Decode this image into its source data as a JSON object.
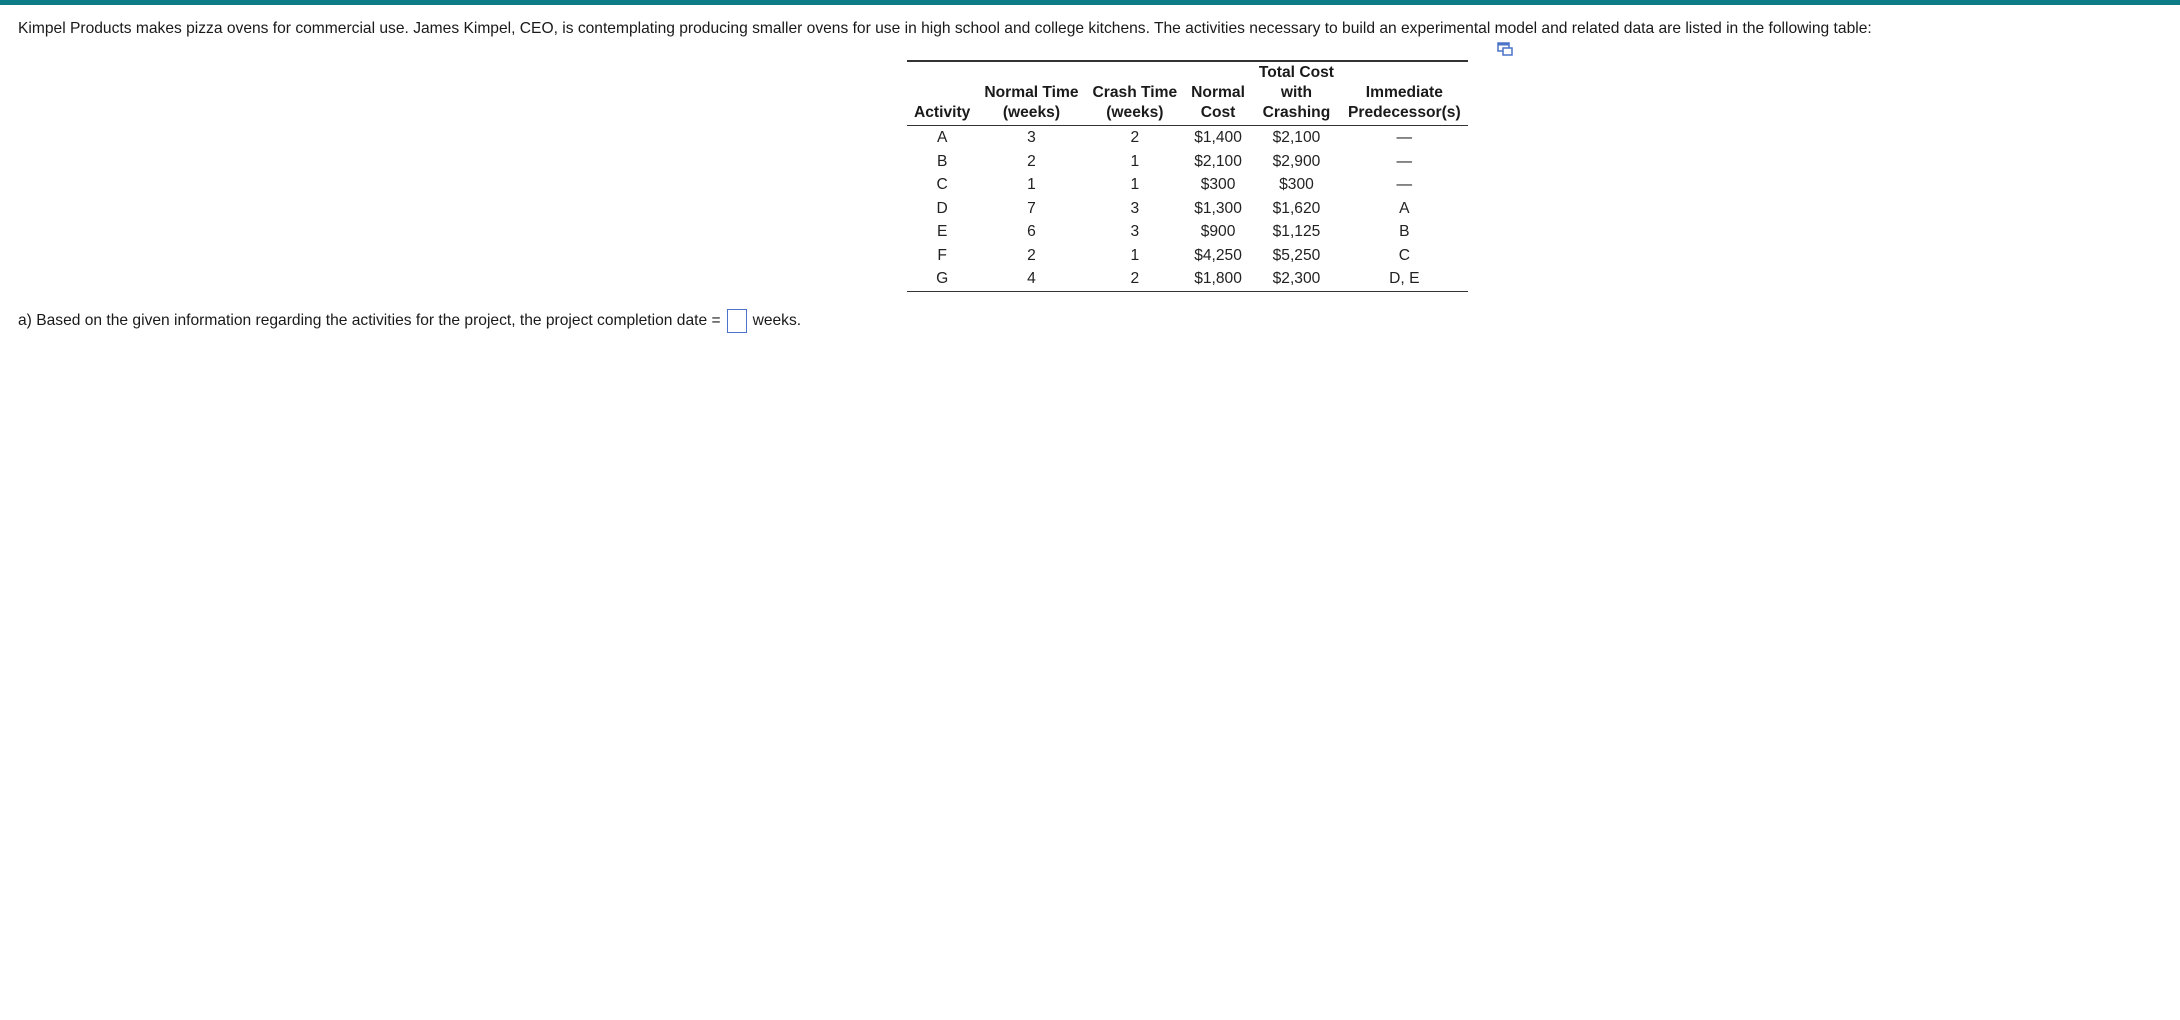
{
  "intro_text": "Kimpel Products makes pizza ovens for commercial use. James Kimpel, CEO, is contemplating producing smaller ovens for use in high school and college kitchens. The activities necessary to build an experimental model and related data are listed in the following table:",
  "table": {
    "headers": [
      [
        "Activity"
      ],
      [
        "Normal Time",
        "(weeks)"
      ],
      [
        "Crash Time",
        "(weeks)"
      ],
      [
        "Normal",
        "Cost"
      ],
      [
        "Total Cost",
        "with",
        "Crashing"
      ],
      [
        "Immediate",
        "Predecessor(s)"
      ]
    ],
    "rows": [
      [
        "A",
        "3",
        "2",
        "$1,400",
        "$2,100",
        "—"
      ],
      [
        "B",
        "2",
        "1",
        "$2,100",
        "$2,900",
        "—"
      ],
      [
        "C",
        "1",
        "1",
        "$300",
        "$300",
        "—"
      ],
      [
        "D",
        "7",
        "3",
        "$1,300",
        "$1,620",
        "A"
      ],
      [
        "E",
        "6",
        "3",
        "$900",
        "$1,125",
        "B"
      ],
      [
        "F",
        "2",
        "1",
        "$4,250",
        "$5,250",
        "C"
      ],
      [
        "G",
        "4",
        "2",
        "$1,800",
        "$2,300",
        "D, E"
      ]
    ]
  },
  "question": {
    "prefix": "a) Based on the given information regarding the activities for the project, the project completion date =",
    "answer_value": "",
    "suffix": "weeks."
  },
  "icons": {
    "popout": "popout-window-icon"
  },
  "colors": {
    "top_bar": "#0e7c86",
    "answer_border": "#4b73c8"
  }
}
